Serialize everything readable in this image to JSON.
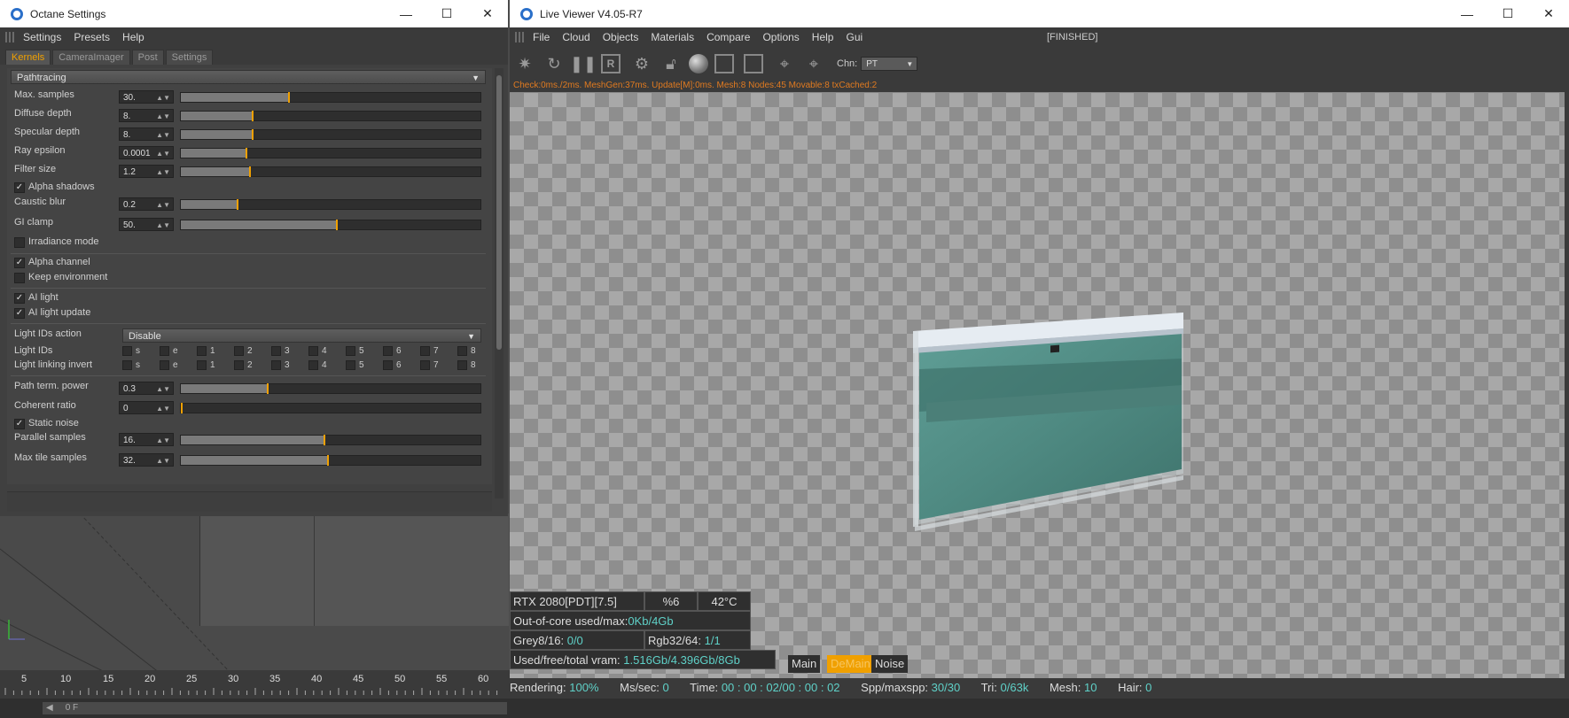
{
  "octane": {
    "title": "Octane Settings",
    "menu": [
      "Settings",
      "Presets",
      "Help"
    ],
    "tabs": [
      "Kernels",
      "CameraImager",
      "Post",
      "Settings"
    ],
    "kernel": "Pathtracing",
    "params": [
      {
        "label": "Max. samples",
        "value": "30.",
        "level": 0.36
      },
      {
        "label": "Diffuse depth",
        "value": "8.",
        "level": 0.24
      },
      {
        "label": "Specular depth",
        "value": "8.",
        "level": 0.24
      },
      {
        "label": "Ray epsilon",
        "value": "0.0001",
        "level": 0.22
      },
      {
        "label": "Filter size",
        "value": "1.2",
        "level": 0.23
      }
    ],
    "alpha_shadows": "Alpha shadows",
    "params2": [
      {
        "label": "Caustic blur",
        "value": "0.2",
        "level": 0.19
      },
      {
        "label": "GI clamp",
        "value": "50.",
        "level": 0.52
      }
    ],
    "irradiance": "Irradiance mode",
    "alpha_channel": "Alpha channel",
    "keep_env": "Keep environment",
    "ai_light": "AI light",
    "ai_light_update": "AI light update",
    "light_ids_action_label": "Light IDs action",
    "light_ids_action": "Disable",
    "light_ids_label": "Light IDs",
    "light_link_label": "Light linking invert",
    "id_options": [
      "s",
      "e",
      "1",
      "2",
      "3",
      "4",
      "5",
      "6",
      "7",
      "8"
    ],
    "params3": [
      {
        "label": "Path term. power",
        "value": "0.3",
        "level": 0.29
      },
      {
        "label": "Coherent ratio",
        "value": "0",
        "level": 0.0
      }
    ],
    "static_noise": "Static noise",
    "params4": [
      {
        "label": "Parallel samples",
        "value": "16.",
        "level": 0.48
      },
      {
        "label": "Max tile samples",
        "value": "32.",
        "level": 0.49
      }
    ]
  },
  "viewer": {
    "title": "Live Viewer V4.05-R7",
    "menu": [
      "File",
      "Cloud",
      "Objects",
      "Materials",
      "Compare",
      "Options",
      "Help",
      "Gui"
    ],
    "finished": "[FINISHED]",
    "chn_label": "Chn:",
    "chn_value": "PT",
    "status_line": "Check:0ms./2ms. MeshGen:37ms. Update[M]:0ms. Mesh:8 Nodes:45 Movable:8 txCached:2",
    "gpu": "RTX 2080[PDT][7.5]",
    "gpu_pct": "%6",
    "gpu_temp": "42°C",
    "ooc_label": "Out-of-core used/max:",
    "ooc_value": "0Kb/4Gb",
    "grey_label": "Grey8/16:",
    "grey_value": "0/0",
    "rgb_label": "Rgb32/64:",
    "rgb_value": "1/1",
    "vram_label": "Used/free/total vram:",
    "vram_value": "1.516Gb/4.396Gb/8Gb",
    "passes": [
      "Main",
      "DeMain",
      "Noise"
    ],
    "rendering_label": "Rendering:",
    "rendering_value": "100%",
    "mssec_label": "Ms/sec:",
    "mssec_value": "0",
    "time_label": "Time:",
    "time_value": "00 : 00 : 02/00 : 00 : 02",
    "spp_label": "Spp/maxspp:",
    "spp_value": "30/30",
    "tri_label": "Tri:",
    "tri_value": "0/63k",
    "mesh_label": "Mesh:",
    "mesh_value": "10",
    "hair_label": "Hair:",
    "hair_value": "0"
  },
  "timeline": {
    "ticks": [
      "5",
      "10",
      "15",
      "20",
      "25",
      "30",
      "35",
      "40",
      "45",
      "50",
      "55",
      "60"
    ],
    "frame": "0 F"
  },
  "colors": {
    "accent": "#f0a000",
    "cyan": "#5fd1c8",
    "status": "#e07a20"
  }
}
